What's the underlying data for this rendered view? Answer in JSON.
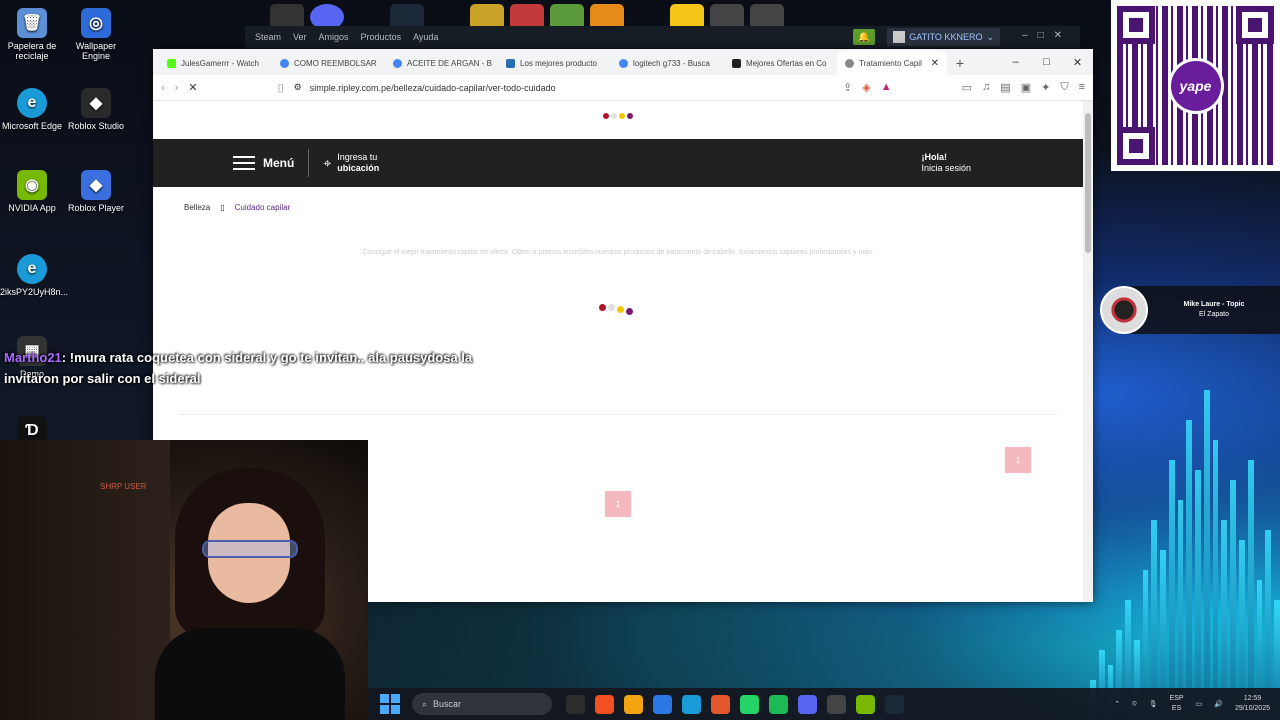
{
  "desktop": {
    "icons": [
      {
        "label": "Papelera de reciclaje",
        "color": "#5b8fd6"
      },
      {
        "label": "Wallpaper Engine",
        "color": "#2d6bd8"
      },
      {
        "label": "Microsoft Edge",
        "color": "#1a9ad6"
      },
      {
        "label": "Roblox Studio",
        "color": "#2a2a2a"
      },
      {
        "label": "NVIDIA App",
        "color": "#76b900"
      },
      {
        "label": "Roblox Player",
        "color": "#3b6fe0"
      },
      {
        "label": "2iksPY2UyH8n...",
        "color": "#1a9ad6"
      },
      {
        "label": "Demo",
        "color": "#333333"
      }
    ]
  },
  "steam": {
    "logo": "Steam",
    "menu": [
      "Ver",
      "Amigos",
      "Productos",
      "Ayuda"
    ],
    "username": "GATITO KKNERO"
  },
  "browser": {
    "tabs": [
      {
        "label": "JulesGamerrr - Watch",
        "color": "#53fc18"
      },
      {
        "label": "COMO REEMBOLSAR",
        "color": "#4285f4"
      },
      {
        "label": "ACEITE DE ARGAN - B",
        "color": "#4285f4"
      },
      {
        "label": "Los mejores producto",
        "color": "#2b6cb0"
      },
      {
        "label": "logitech g733 - Busca",
        "color": "#4285f4"
      },
      {
        "label": "Mejores Ofertas en Co",
        "color": "#222222"
      },
      {
        "label": "Tratamiento Capil",
        "color": "#888888"
      }
    ],
    "url": "simple.ripley.com.pe/belleza/cuidado-capilar/ver-todo-cuidado"
  },
  "page": {
    "menu_label": "Menú",
    "location_line1": "Ingresa tu",
    "location_line2": "ubicación",
    "greeting_line1": "¡Hola!",
    "greeting_line2": "Inicia sesión",
    "breadcrumb_root": "Belleza",
    "breadcrumb_current": "Cuidado capilar",
    "description": "Consigue el mejor tratamiento capilar en oferta. Obten a precios increíbles nuestros productos de tratamiento de cabello, tratamientos capilares profesionales y más.",
    "pager_1": "1",
    "pager_2": "1",
    "loader_colors": [
      "#b0102a",
      "#e0e0e0",
      "#f2c500",
      "#7a1a6a"
    ]
  },
  "chat": {
    "user": "Martho21",
    "message": ": !mura rata coquetea con sideral y go te invitan.. ala pausydosa la invitaron por salir con el sideral"
  },
  "webcam": {
    "overlay_text": "SHRP USER"
  },
  "qr": {
    "brand": "yape"
  },
  "now_playing": {
    "title": "Mike Laure - Topic",
    "subtitle": "El Zapato"
  },
  "taskbar": {
    "search_placeholder": "Buscar",
    "apps": [
      "#2d2d2d",
      "#f25022",
      "#f2a30f",
      "#2b78e4",
      "#1a9ad6",
      "#e4572e",
      "#25d366",
      "#1db954",
      "#5865f2",
      "#444444",
      "#76b900",
      "#1b2838"
    ],
    "lang_top": "ESP",
    "lang_bottom": "ES",
    "time": "12:59",
    "date": "29/10/2025"
  }
}
